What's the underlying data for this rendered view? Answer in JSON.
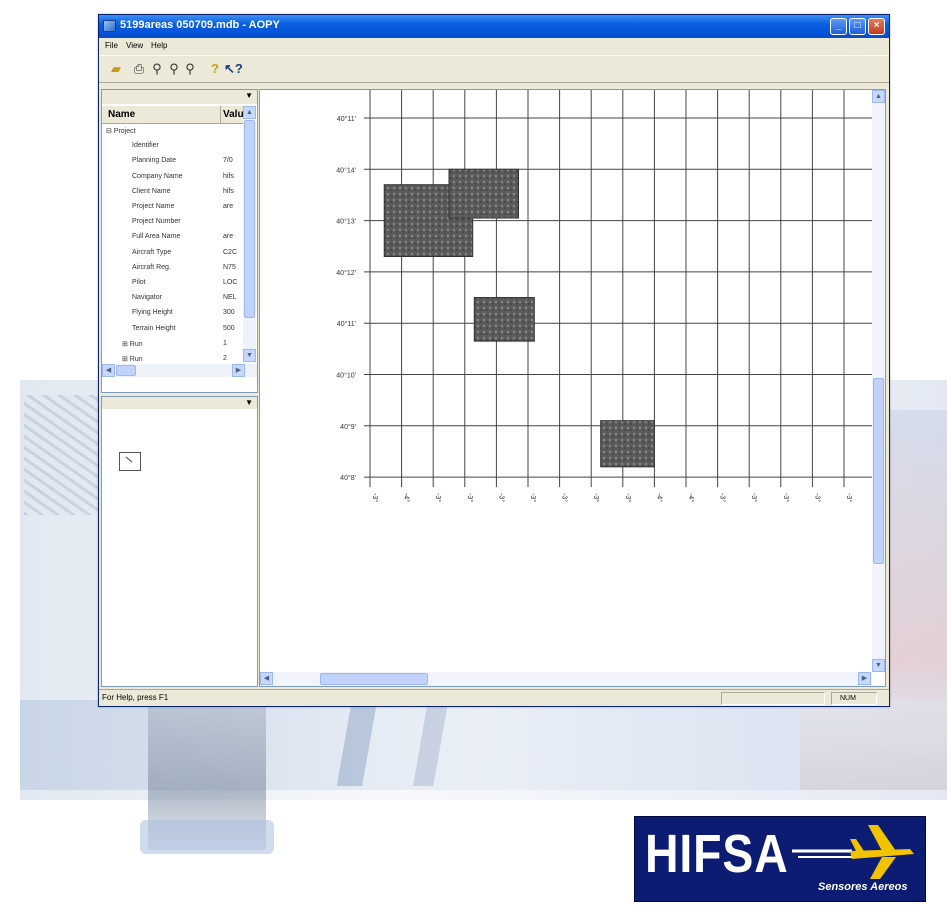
{
  "window": {
    "title": "5199areas 050709.mdb - AOPY",
    "controls": [
      "minimize",
      "maximize",
      "close"
    ]
  },
  "menubar": {
    "items": [
      "File",
      "View",
      "Help"
    ]
  },
  "toolbar": {
    "icons": [
      "open-folder-icon",
      "print-icon",
      "zoom-icon",
      "zoom-in-icon",
      "zoom-out-icon",
      "help-icon",
      "context-help-icon"
    ]
  },
  "tree": {
    "columns": {
      "name": "Name",
      "value": "Valu"
    },
    "rows": [
      {
        "name": "Project",
        "value": "",
        "expander": "⊟",
        "level": 0
      },
      {
        "name": "Identifier",
        "value": "",
        "expander": "",
        "level": 1
      },
      {
        "name": "Planning Date",
        "value": "7/0",
        "expander": "",
        "level": 1
      },
      {
        "name": "Company Name",
        "value": "hifs",
        "expander": "",
        "level": 1
      },
      {
        "name": "Client Name",
        "value": "hifs",
        "expander": "",
        "level": 1
      },
      {
        "name": "Project Name",
        "value": "are",
        "expander": "",
        "level": 1
      },
      {
        "name": "Project Number",
        "value": "",
        "expander": "",
        "level": 1
      },
      {
        "name": "Full Area Name",
        "value": "are",
        "expander": "",
        "level": 1
      },
      {
        "name": "Aircraft Type",
        "value": "C2C",
        "expander": "",
        "level": 1
      },
      {
        "name": "Aircraft Reg.",
        "value": "N75",
        "expander": "",
        "level": 1
      },
      {
        "name": "Pilot",
        "value": "LOC",
        "expander": "",
        "level": 1
      },
      {
        "name": "Navigator",
        "value": "NEL",
        "expander": "",
        "level": 1
      },
      {
        "name": "Flying Height",
        "value": "300",
        "expander": "",
        "level": 1
      },
      {
        "name": "Terrain Height",
        "value": "500",
        "expander": "",
        "level": 1
      },
      {
        "name": "Run",
        "value": "1",
        "expander": "⊞",
        "level": 1
      },
      {
        "name": "Run",
        "value": "2",
        "expander": "⊞",
        "level": 1
      }
    ]
  },
  "map": {
    "lat_labels": [
      "40°11'",
      "40°14'",
      "40°13'",
      "40°12'",
      "40°11'",
      "40°10'",
      "40°9'",
      "40°8'"
    ],
    "lon_labels": [
      "-3°",
      "-4°",
      "-3°",
      "-3°",
      "-3°",
      "-3°",
      "-3°",
      "-3°",
      "-3°",
      "-4°",
      "-4°",
      "-3°",
      "-3°",
      "-3°",
      "-3°",
      "-3°"
    ]
  },
  "statusbar": {
    "help_text": "For Help, press F1",
    "indicator": "NUM"
  },
  "logo": {
    "name": "HIFSA",
    "tagline": "Sensores Aereos"
  },
  "colors": {
    "titlebar": "#0553d8",
    "logo_bg": "#0c1c73",
    "logo_plane": "#f2c400"
  }
}
